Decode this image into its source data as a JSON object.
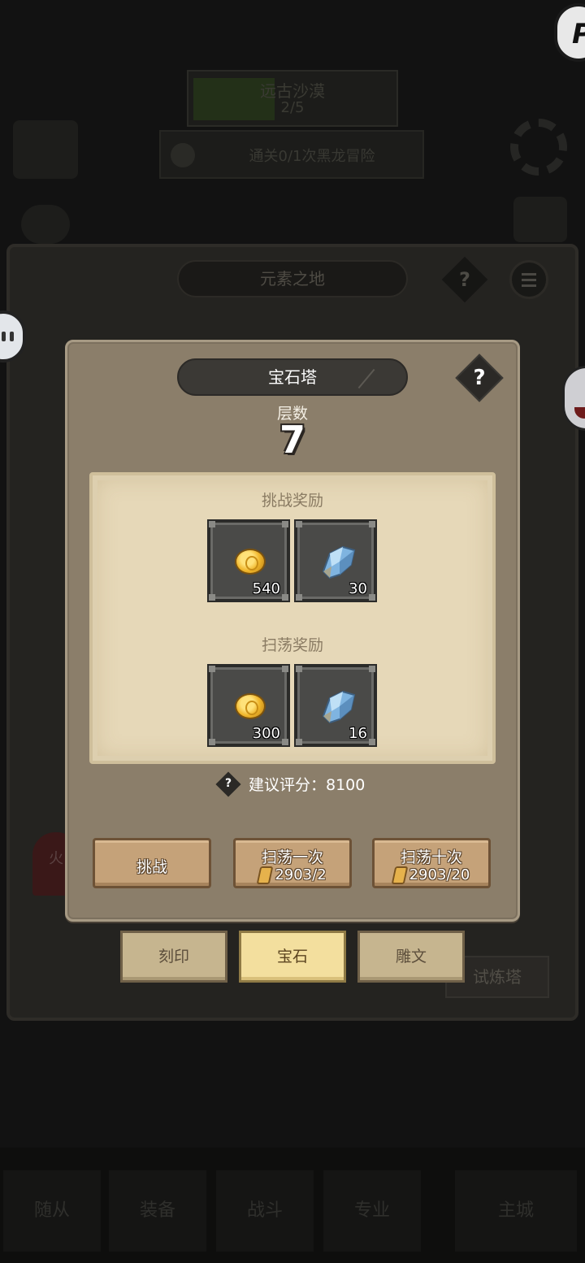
{
  "background": {
    "top_banner": {
      "title": "远古沙漠",
      "progress": "2/5"
    },
    "task_text": "通关0/1次黑龙冒险",
    "panel_title": "元素之地",
    "help_symbol": "?",
    "side_button": "试炼塔",
    "fire_label": "火",
    "bottom_nav": [
      "随从",
      "装备",
      "战斗",
      "专业",
      "主城"
    ],
    "logo_letter": "P"
  },
  "dialog": {
    "title": "宝石塔",
    "help_symbol": "?",
    "floor_label": "层数",
    "floor_value": "7",
    "challenge_rewards": {
      "title": "挑战奖励",
      "items": [
        {
          "icon": "gold-coin-icon",
          "qty": "540"
        },
        {
          "icon": "blue-crystal-icon",
          "qty": "30"
        }
      ]
    },
    "sweep_rewards": {
      "title": "扫荡奖励",
      "items": [
        {
          "icon": "gold-coin-icon",
          "qty": "300"
        },
        {
          "icon": "blue-crystal-icon",
          "qty": "16"
        }
      ]
    },
    "score_help": "?",
    "recommended_score": "建议评分：8100",
    "buttons": {
      "challenge": "挑战",
      "sweep_once": {
        "label": "扫荡一次",
        "cost": "2903/2"
      },
      "sweep_ten": {
        "label": "扫荡十次",
        "cost": "2903/20"
      }
    }
  },
  "tabs": [
    {
      "label": "刻印",
      "active": false
    },
    {
      "label": "宝石",
      "active": true
    },
    {
      "label": "雕文",
      "active": false
    }
  ],
  "colors": {
    "dialog_bg": "#8b7e6a",
    "parchment": "#e6d8b8",
    "button_wood": "#c5a279",
    "active_tab": "#f3df9e"
  }
}
